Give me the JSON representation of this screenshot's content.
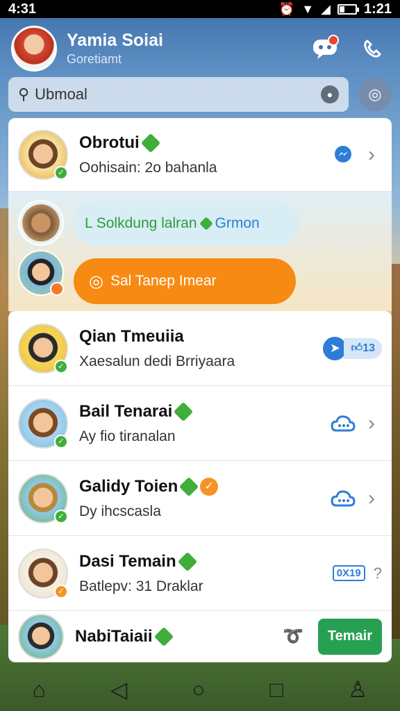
{
  "status": {
    "time_left": "4:31",
    "time_right": "1:21",
    "battery_level": 0.3
  },
  "header": {
    "name": "Yamia Soiai",
    "subtitle": "Goretiamt",
    "notification_icon": "chat-bubble-icon",
    "call_icon": "phone-icon"
  },
  "search": {
    "value": "Ubmoal",
    "placeholder": ""
  },
  "bubbles": {
    "first_green": "L Solkdung lalran",
    "first_blue": "Grmon",
    "second": "Sal Tanep Imear"
  },
  "chats": [
    {
      "name": "Obrotui",
      "message": "Oohisain: 2o bahanla",
      "verified": true
    },
    {
      "name": "Qian Tmeuiia",
      "message": "Xaesalun dedi Brriyaara",
      "verified": false,
      "pill_text": "13"
    },
    {
      "name": "Bail Tenarai",
      "message": "Ay fio tiranalan",
      "verified": true
    },
    {
      "name": "Galidy Toien",
      "message": "Dy ihcscasla",
      "verified": true,
      "orange_check": true
    },
    {
      "name": "Dasi Temain",
      "message": "Batlepv: 31 Draklar",
      "verified": true,
      "count_badge": "0X19"
    },
    {
      "name": "NabiTaiaii",
      "message": "",
      "verified": true,
      "cta": "Temair"
    }
  ],
  "colors": {
    "accent_blue": "#2d7dd8",
    "verified_green": "#3fae3a",
    "cta_green": "#28a052",
    "bubble_orange": "#f78a12"
  }
}
